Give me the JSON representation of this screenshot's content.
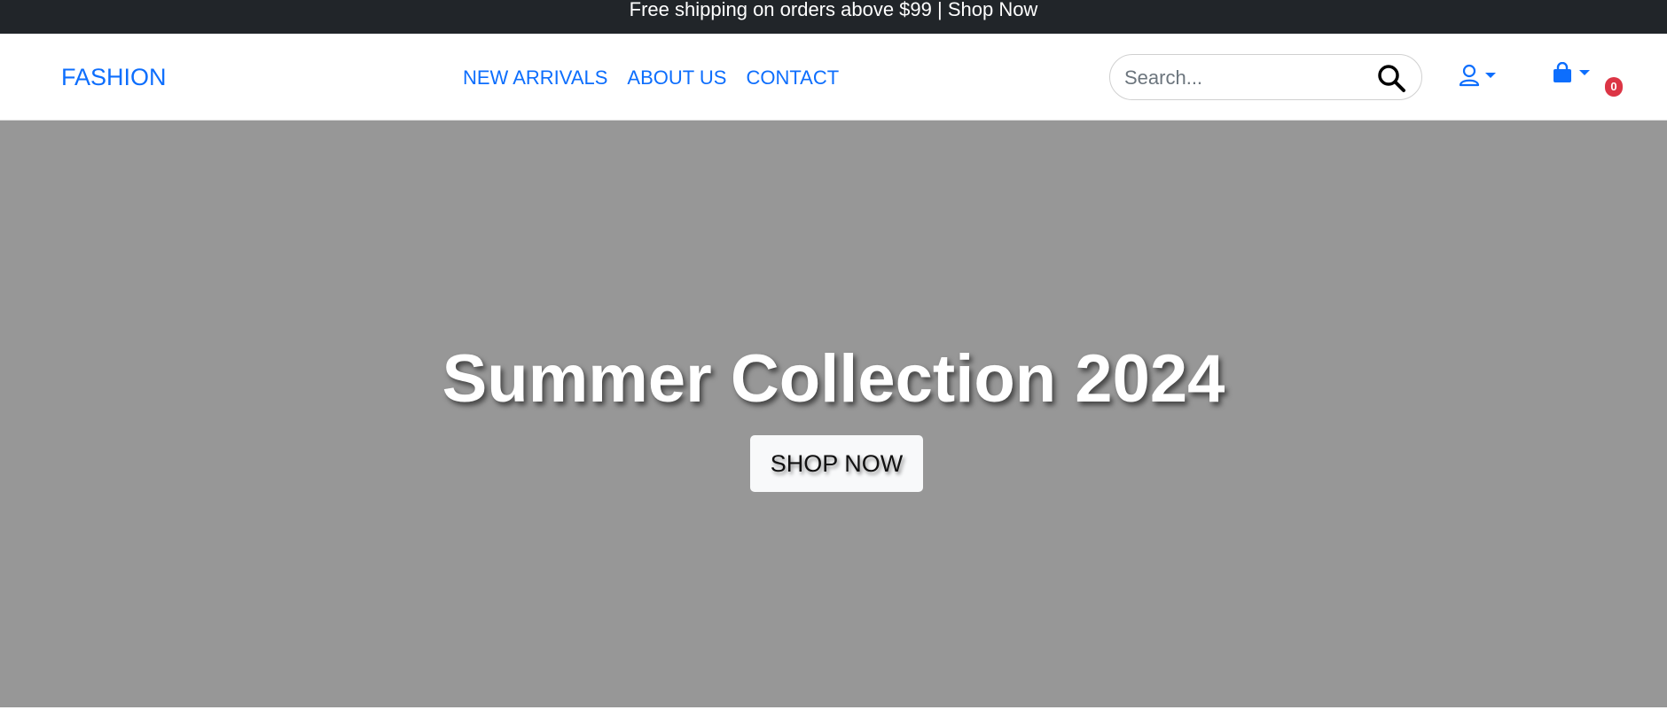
{
  "announcement": {
    "text": "Free shipping on orders above $99 | Shop Now"
  },
  "header": {
    "brand": "FASHION",
    "nav": [
      "NEW ARRIVALS",
      "ABOUT US",
      "CONTACT"
    ],
    "search": {
      "placeholder": "Search...",
      "value": ""
    },
    "cart_count": "0"
  },
  "hero": {
    "title": "Summer Collection 2024",
    "cta_label": "SHOP NOW"
  },
  "colors": {
    "accent": "#0d6efd",
    "topbar": "#212529",
    "hero_bg": "#979797",
    "badge": "#dc3545"
  }
}
